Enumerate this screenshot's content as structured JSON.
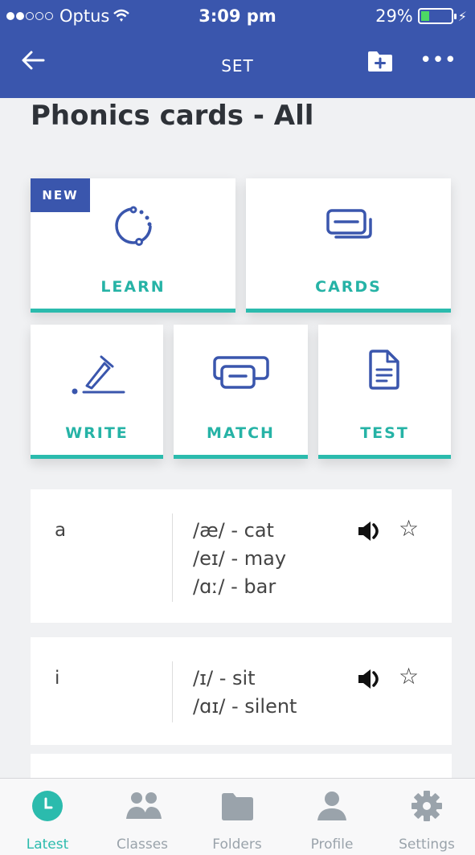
{
  "status_bar": {
    "carrier": "Optus",
    "time": "3:09 pm",
    "battery": "29%",
    "battery_level": 0.29
  },
  "nav": {
    "title": "SET",
    "back_icon": "arrow-left-icon",
    "folder_icon": "folder-add-icon",
    "more_label": "•••"
  },
  "page": {
    "title": "Phonics cards - All"
  },
  "modes": {
    "new_badge": "NEW",
    "learn": "LEARN",
    "cards": "CARDS",
    "write": "WRITE",
    "match": "MATCH",
    "test": "TEST"
  },
  "terms": [
    {
      "term": "a",
      "definitions": [
        "/æ/ - cat",
        "/eɪ/ - may",
        "/ɑː/ - bar"
      ]
    },
    {
      "term": "i",
      "definitions": [
        "/ɪ/ - sit",
        "/ɑɪ/ - silent"
      ]
    }
  ],
  "tabbar": {
    "tabs": [
      {
        "label": "Latest",
        "icon": "clock-icon"
      },
      {
        "label": "Classes",
        "icon": "people-icon"
      },
      {
        "label": "Folders",
        "icon": "folder-icon"
      },
      {
        "label": "Profile",
        "icon": "person-icon"
      },
      {
        "label": "Settings",
        "icon": "gear-icon"
      }
    ],
    "active": "Latest"
  },
  "colors": {
    "header": "#3a56ad",
    "accent": "#2bbbad",
    "icon_blue": "#3a56ad",
    "tab_inactive": "#9aa3ab"
  }
}
